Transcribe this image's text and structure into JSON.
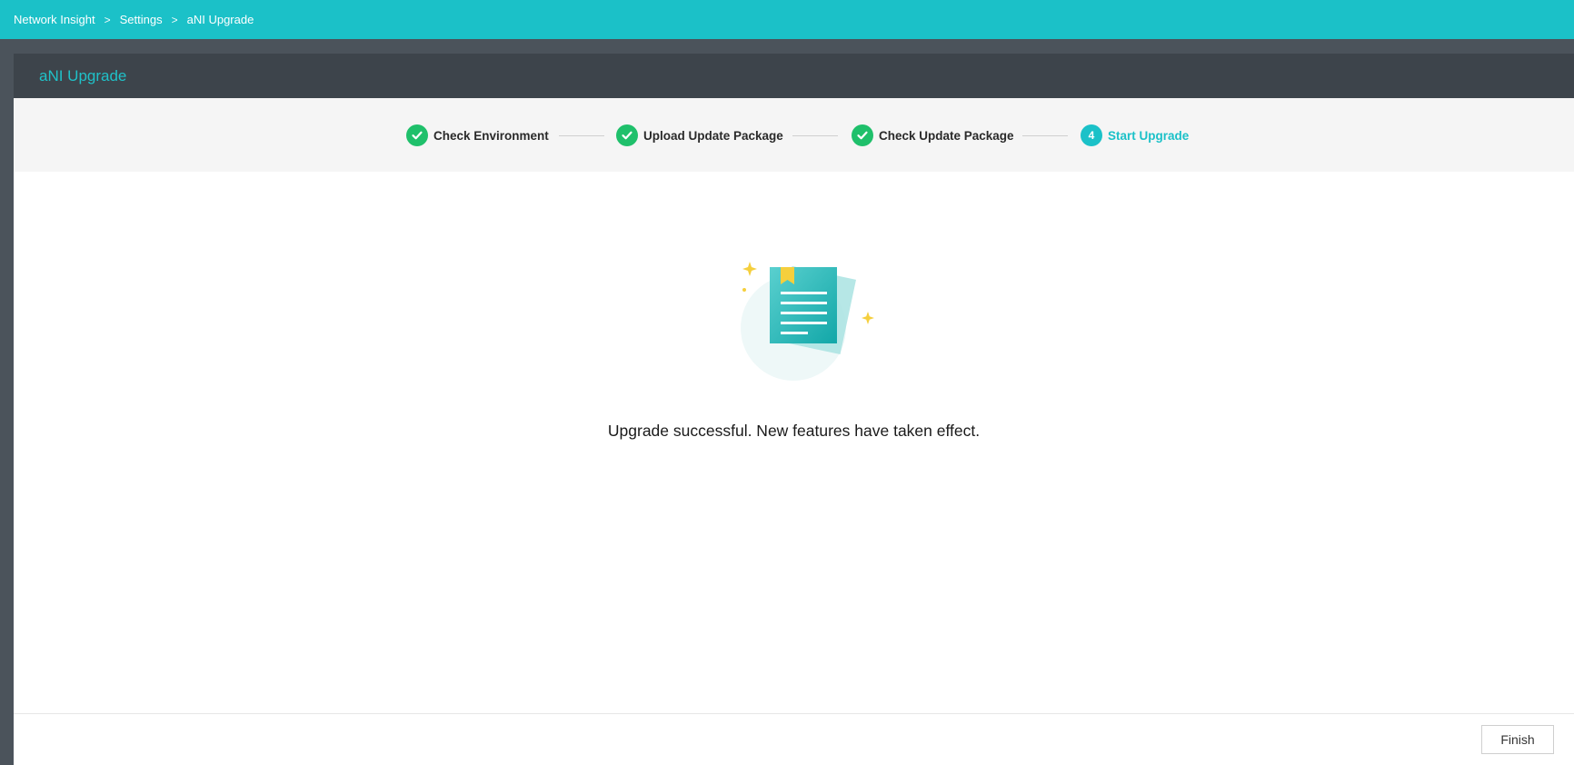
{
  "breadcrumb": {
    "items": [
      "Network Insight",
      "Settings",
      "aNI Upgrade"
    ],
    "separator": ">"
  },
  "panel": {
    "title": "aNI Upgrade"
  },
  "steps": [
    {
      "label": "Check Environment",
      "status": "done"
    },
    {
      "label": "Upload Update Package",
      "status": "done"
    },
    {
      "label": "Check Update Package",
      "status": "done"
    },
    {
      "label": "Start Upgrade",
      "status": "active",
      "number": "4"
    }
  ],
  "result": {
    "message": "Upgrade successful. New features have taken effect.",
    "icon": "document-success-icon"
  },
  "footer": {
    "finish_label": "Finish"
  },
  "colors": {
    "brand": "#1bc1c8",
    "done": "#1fc06b",
    "header_bg": "#3d444b",
    "sidebar_bg": "#4b535b"
  }
}
